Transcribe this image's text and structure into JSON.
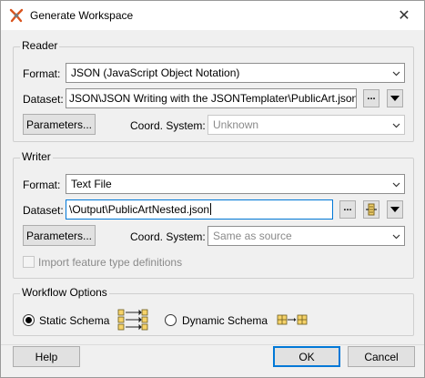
{
  "window": {
    "title": "Generate Workspace",
    "close_glyph": "✕"
  },
  "reader": {
    "legend": "Reader",
    "format_label": "Format:",
    "format_value": "JSON (JavaScript Object Notation)",
    "dataset_label": "Dataset:",
    "dataset_value": "JSON\\JSON Writing with the JSONTemplater\\PublicArt.json\"",
    "browse_label": "...",
    "parameters_label": "Parameters...",
    "coord_label": "Coord. System:",
    "coord_value": "Unknown"
  },
  "writer": {
    "legend": "Writer",
    "format_label": "Format:",
    "format_value": "Text File",
    "dataset_label": "Dataset:",
    "dataset_value": "\\Output\\PublicArtNested.json",
    "browse_label": "...",
    "parameters_label": "Parameters...",
    "coord_label": "Coord. System:",
    "coord_value": "Same as source"
  },
  "import_feature_types_label": "Import feature type definitions",
  "workflow": {
    "legend": "Workflow Options",
    "static_label": "Static Schema",
    "dynamic_label": "Dynamic Schema",
    "selected": "static"
  },
  "footer": {
    "help_label": "Help",
    "ok_label": "OK",
    "cancel_label": "Cancel"
  },
  "colors": {
    "accent": "#0078d7",
    "dialog_bg": "#f0f0f0"
  }
}
